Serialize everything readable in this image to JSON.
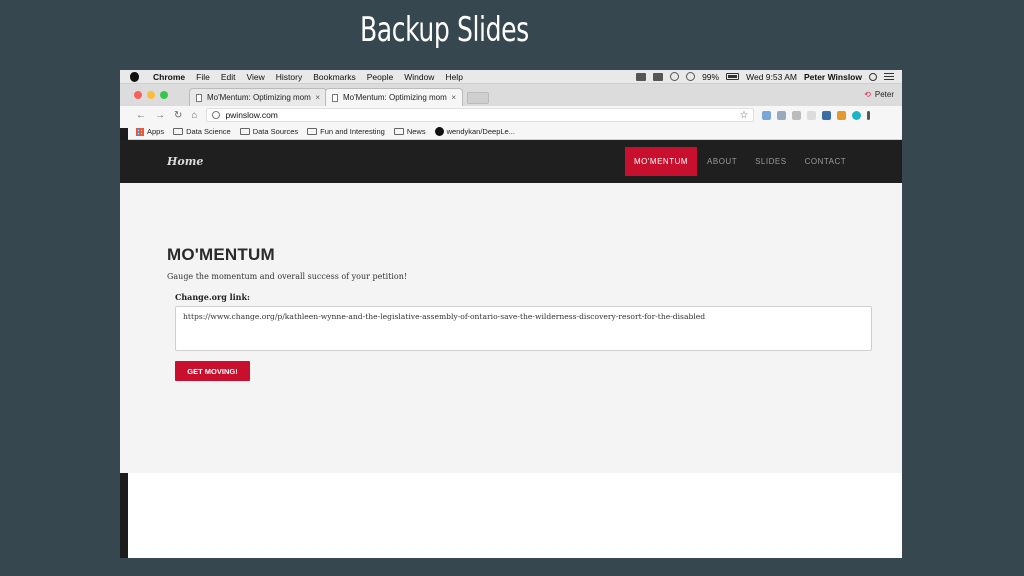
{
  "slide": {
    "title": "Backup Slides"
  },
  "menubar": {
    "app": "Chrome",
    "items": [
      "File",
      "Edit",
      "View",
      "History",
      "Bookmarks",
      "People",
      "Window",
      "Help"
    ],
    "battery": "99%",
    "clock": "Wed 9:53 AM",
    "user": "Peter Winslow"
  },
  "tabs": [
    {
      "title": "Mo'Mentum: Optimizing mom",
      "close": "×"
    },
    {
      "title": "Mo'Mentum: Optimizing mom",
      "close": "×"
    }
  ],
  "profile": {
    "name": "Peter"
  },
  "address": {
    "url": "pwinslow.com"
  },
  "bookmarks": [
    "Apps",
    "Data Science",
    "Data Sources",
    "Fun and Interesting",
    "News",
    "wendykan/DeepLe..."
  ],
  "site": {
    "home": "Home",
    "nav": [
      "MO'MENTUM",
      "ABOUT",
      "SLIDES",
      "CONTACT"
    ],
    "heading": "MO'MENTUM",
    "subtitle": "Gauge the momentum and overall success of your petition!",
    "field_label": "Change.org link:",
    "field_value": "https://www.change.org/p/kathleen-wynne-and-the-legislative-assembly-of-ontario-save-the-wilderness-discovery-resort-for-the-disabled",
    "button": "GET MOVING!"
  },
  "colors": {
    "accent": "#c8102e",
    "slide_bg": "#37474f",
    "nav_bg": "#1f1f1f"
  },
  "icons": [
    "apple-icon",
    "reload-icon",
    "back-icon",
    "forward-icon",
    "home-icon",
    "star-icon",
    "github-icon"
  ]
}
